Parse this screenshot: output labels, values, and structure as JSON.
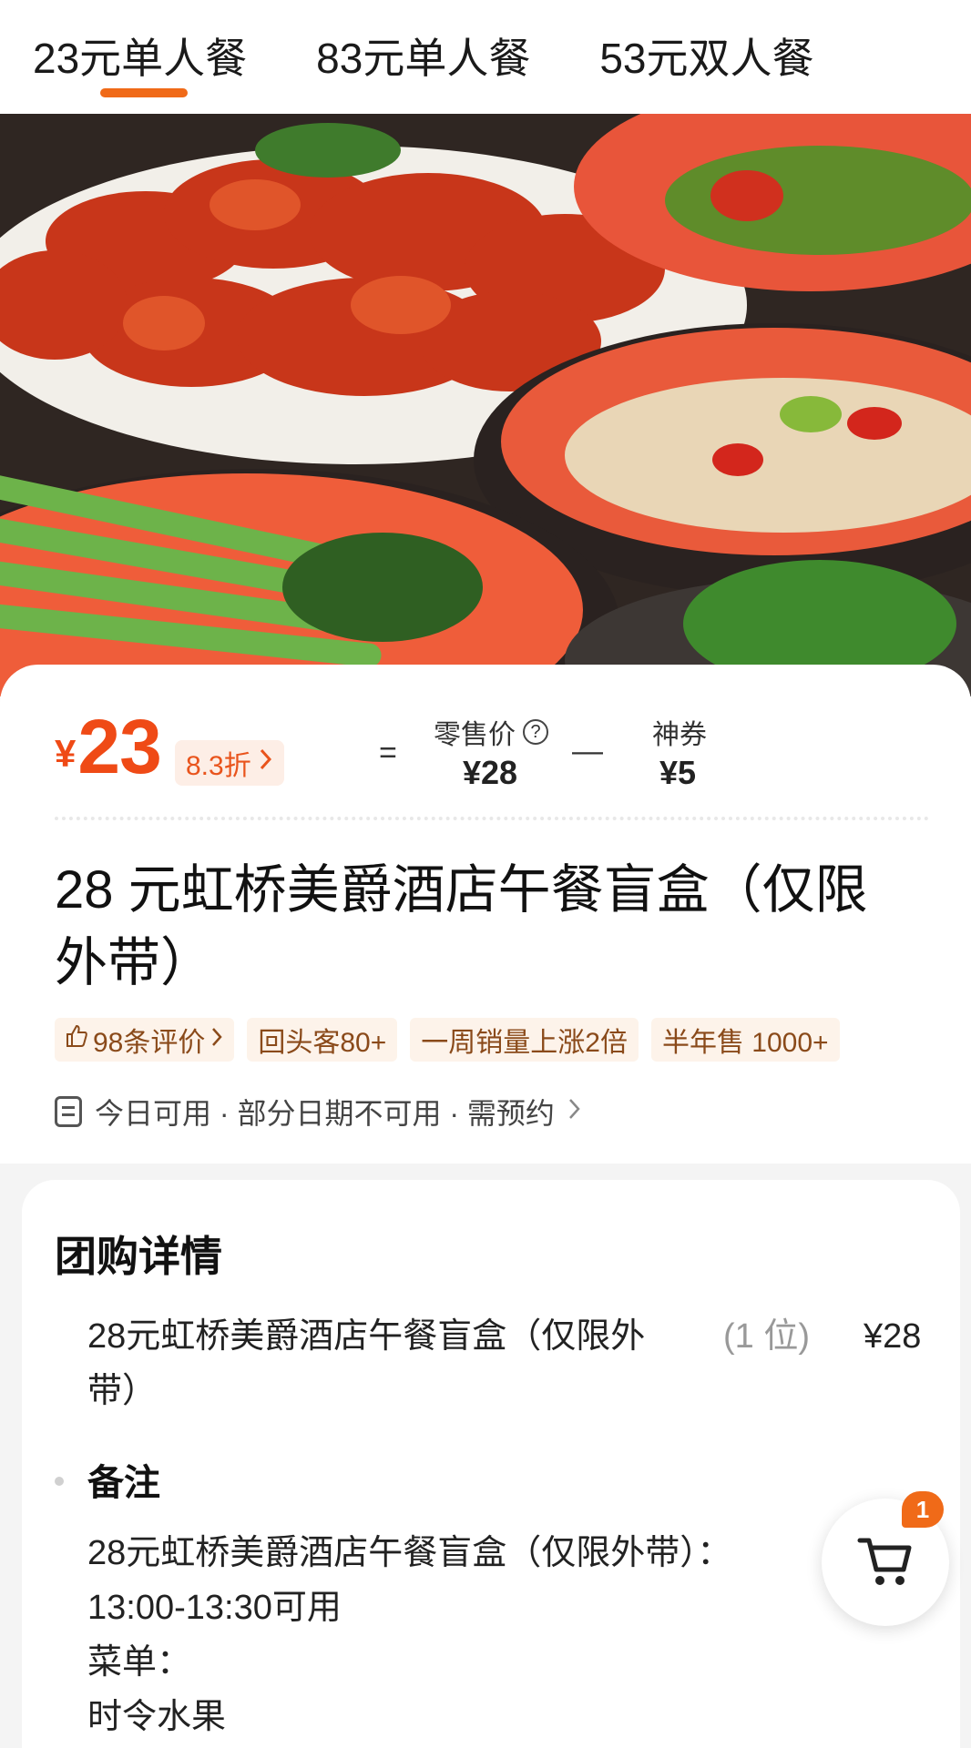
{
  "tabs": [
    {
      "label": "23元单人餐",
      "active": true
    },
    {
      "label": "83元单人餐",
      "active": false
    },
    {
      "label": "53元双人餐",
      "active": false
    }
  ],
  "price": {
    "currency_symbol": "¥",
    "amount": "23",
    "discount": "8.3折",
    "eq": "=",
    "minus": "—",
    "retail_label": "零售价",
    "retail_value": "¥28",
    "coupon_label": "神券",
    "coupon_value": "¥5"
  },
  "product": {
    "title": "28 元虹桥美爵酒店午餐盲盒（仅限外带）",
    "tags": [
      "98条评价",
      "回头客80+",
      "一周销量上涨2倍",
      "半年售 1000+"
    ],
    "availability": "今日可用 · 部分日期不可用 · 需预约"
  },
  "details": {
    "section_title": "团购详情",
    "item": {
      "name": "28元虹桥美爵酒店午餐盲盒（仅限外带）",
      "qty": "(1 位)",
      "price": "¥28"
    },
    "note_title": "备注",
    "note_lines": [
      "28元虹桥美爵酒店午餐盲盒（仅限外带）：",
      "13:00-13:30可用",
      "菜单：",
      "时令水果"
    ]
  },
  "cart": {
    "badge": "1"
  },
  "colors": {
    "accent": "#f06a18",
    "price": "#ef4a16"
  }
}
